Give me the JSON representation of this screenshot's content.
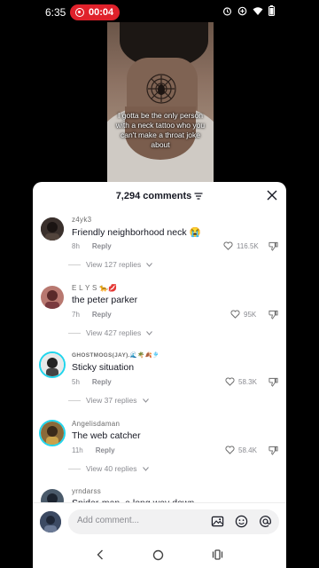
{
  "status_bar": {
    "time": "6:35",
    "recording_time": "00:04",
    "icons": [
      "alarm-icon",
      "data-saver-icon",
      "wifi-icon",
      "battery-icon"
    ]
  },
  "video": {
    "caption": "I gotta be the only person with a neck tattoo who you can't make a throat joke about"
  },
  "comments_panel": {
    "title": "7,294 comments",
    "comments": [
      {
        "username": "z4yk3",
        "text": "Friendly neighborhood neck 😭",
        "time": "8h",
        "reply_label": "Reply",
        "likes": "116.5K",
        "view_replies": "View 127 replies"
      },
      {
        "username": "E L Y S 🐆💋",
        "text": "the peter parker",
        "time": "7h",
        "reply_label": "Reply",
        "likes": "95K",
        "view_replies": "View 427 replies"
      },
      {
        "username": "GHOSTMOGS(JAY).🌊🌴🍂🎐",
        "text": "Sticky situation",
        "time": "5h",
        "reply_label": "Reply",
        "likes": "58.3K",
        "view_replies": "View 37 replies"
      },
      {
        "username": "Angelisdaman",
        "text": "The web catcher",
        "time": "11h",
        "reply_label": "Reply",
        "likes": "58.4K",
        "view_replies": "View 40 replies"
      },
      {
        "username": "yrndarss",
        "text": "Spider-man, a long way down",
        "time": "",
        "reply_label": "",
        "likes": "",
        "view_replies": ""
      }
    ]
  },
  "input": {
    "placeholder": "Add comment..."
  },
  "colors": {
    "accent_red": "#e0212b",
    "ring_cyan": "#20d5ec"
  }
}
